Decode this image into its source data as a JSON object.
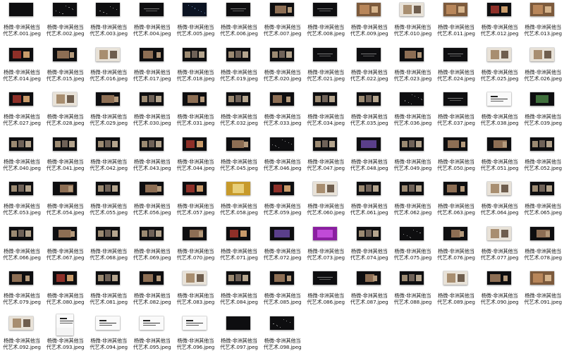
{
  "finder": {
    "file_prefix_line1": "杨微-非洲其他当",
    "file_prefix_line2": "代艺术",
    "extension": ".jpeg",
    "files": [
      {
        "num": "001",
        "label1": "杨微-非洲其他当",
        "label2": "代艺术.001.jpeg",
        "style": "dark-empty"
      },
      {
        "num": "002",
        "label1": "杨微-非洲其他当",
        "label2": "代艺术.002.jpeg",
        "style": "dark-dots"
      },
      {
        "num": "003",
        "label1": "杨微-非洲其他当",
        "label2": "代艺术.003.jpeg",
        "style": "dark-dots"
      },
      {
        "num": "004",
        "label1": "杨微-非洲其他当",
        "label2": "代艺术.004.jpeg",
        "style": "dark-text"
      },
      {
        "num": "005",
        "label1": "杨微-非洲其他当",
        "label2": "代艺术.005.jpeg",
        "style": "dark-blue"
      },
      {
        "num": "006",
        "label1": "杨微-非洲其他当",
        "label2": "代艺术.006.jpeg",
        "style": "dark-text"
      },
      {
        "num": "007",
        "label1": "杨微-非洲其他当",
        "label2": "代艺术.007.jpeg",
        "style": "dark-photo"
      },
      {
        "num": "008",
        "label1": "杨微-非洲其他当",
        "label2": "代艺术.008.jpeg",
        "style": "dark-text"
      },
      {
        "num": "009",
        "label1": "杨微-非洲其他当",
        "label2": "代艺术.009.jpeg",
        "style": "photo-warm"
      },
      {
        "num": "010",
        "label1": "杨微-非洲其他当",
        "label2": "代艺术.010.jpeg",
        "style": "light-photo"
      },
      {
        "num": "011",
        "label1": "杨微-非洲其他当",
        "label2": "代艺术.011.jpeg",
        "style": "photo-warm"
      },
      {
        "num": "012",
        "label1": "杨微-非洲其他当",
        "label2": "代艺术.012.jpeg",
        "style": "dark-red"
      },
      {
        "num": "013",
        "label1": "杨微-非洲其他当",
        "label2": "代艺术.013.jpeg",
        "style": "photo-warm"
      },
      {
        "num": "014",
        "label1": "杨微-非洲其他当",
        "label2": "代艺术.014.jpeg",
        "style": "dark-red"
      },
      {
        "num": "015",
        "label1": "杨微-非洲其他当",
        "label2": "代艺术.015.jpeg",
        "style": "dark-photo"
      },
      {
        "num": "016",
        "label1": "杨微-非洲其他当",
        "label2": "代艺术.016.jpeg",
        "style": "light-photo"
      },
      {
        "num": "017",
        "label1": "杨微-非洲其他当",
        "label2": "代艺术.017.jpeg",
        "style": "dark-photo"
      },
      {
        "num": "018",
        "label1": "杨微-非洲其他当",
        "label2": "代艺术.018.jpeg",
        "style": "dark-photos"
      },
      {
        "num": "019",
        "label1": "杨微-非洲其他当",
        "label2": "代艺术.019.jpeg",
        "style": "dark-photos"
      },
      {
        "num": "020",
        "label1": "杨微-非洲其他当",
        "label2": "代艺术.020.jpeg",
        "style": "dark-photos"
      },
      {
        "num": "021",
        "label1": "杨微-非洲其他当",
        "label2": "代艺术.021.jpeg",
        "style": "dark-text"
      },
      {
        "num": "022",
        "label1": "杨微-非洲其他当",
        "label2": "代艺术.022.jpeg",
        "style": "dark-text"
      },
      {
        "num": "023",
        "label1": "杨微-非洲其他当",
        "label2": "代艺术.023.jpeg",
        "style": "dark-photo"
      },
      {
        "num": "024",
        "label1": "杨微-非洲其他当",
        "label2": "代艺术.024.jpeg",
        "style": "dark-text"
      },
      {
        "num": "025",
        "label1": "杨微-非洲其他当",
        "label2": "代艺术.025.jpeg",
        "style": "light-photo"
      },
      {
        "num": "026",
        "label1": "杨微-非洲其他当",
        "label2": "代艺术.026.jpeg",
        "style": "light-photo"
      },
      {
        "num": "027",
        "label1": "杨微-非洲其他当",
        "label2": "代艺术.027.jpeg",
        "style": "dark-red"
      },
      {
        "num": "028",
        "label1": "杨微-非洲其他当",
        "label2": "代艺术.028.jpeg",
        "style": "light-photo"
      },
      {
        "num": "029",
        "label1": "杨微-非洲其他当",
        "label2": "代艺术.029.jpeg",
        "style": "dark-photo"
      },
      {
        "num": "030",
        "label1": "杨微-非洲其他当",
        "label2": "代艺术.030.jpeg",
        "style": "dark-photos"
      },
      {
        "num": "031",
        "label1": "杨微-非洲其他当",
        "label2": "代艺术.031.jpeg",
        "style": "dark-photo"
      },
      {
        "num": "032",
        "label1": "杨微-非洲其他当",
        "label2": "代艺术.032.jpeg",
        "style": "dark-photos"
      },
      {
        "num": "033",
        "label1": "杨微-非洲其他当",
        "label2": "代艺术.033.jpeg",
        "style": "dark-photo"
      },
      {
        "num": "034",
        "label1": "杨微-非洲其他当",
        "label2": "代艺术.034.jpeg",
        "style": "dark-photos"
      },
      {
        "num": "035",
        "label1": "杨微-非洲其他当",
        "label2": "代艺术.035.jpeg",
        "style": "dark-photos"
      },
      {
        "num": "036",
        "label1": "杨微-非洲其他当",
        "label2": "代艺术.036.jpeg",
        "style": "dark-dots"
      },
      {
        "num": "037",
        "label1": "杨微-非洲其他当",
        "label2": "代艺术.037.jpeg",
        "style": "dark-text"
      },
      {
        "num": "038",
        "label1": "杨微-非洲其他当",
        "label2": "代艺术.038.jpeg",
        "style": "white-doc"
      },
      {
        "num": "039",
        "label1": "杨微-非洲其他当",
        "label2": "代艺术.039.jpeg",
        "style": "dark-green"
      },
      {
        "num": "040",
        "label1": "杨微-非洲其他当",
        "label2": "代艺术.040.jpeg",
        "style": "dark-photos"
      },
      {
        "num": "041",
        "label1": "杨微-非洲其他当",
        "label2": "代艺术.041.jpeg",
        "style": "dark-photos"
      },
      {
        "num": "042",
        "label1": "杨微-非洲其他当",
        "label2": "代艺术.042.jpeg",
        "style": "dark-photos"
      },
      {
        "num": "043",
        "label1": "杨微-非洲其他当",
        "label2": "代艺术.043.jpeg",
        "style": "dark-photos"
      },
      {
        "num": "044",
        "label1": "杨微-非洲其他当",
        "label2": "代艺术.044.jpeg",
        "style": "dark-red"
      },
      {
        "num": "045",
        "label1": "杨微-非洲其他当",
        "label2": "代艺术.045.jpeg",
        "style": "dark-photo"
      },
      {
        "num": "046",
        "label1": "杨微-非洲其他当",
        "label2": "代艺术.046.jpeg",
        "style": "dark-dots"
      },
      {
        "num": "047",
        "label1": "杨微-非洲其他当",
        "label2": "代艺术.047.jpeg",
        "style": "dark-photos"
      },
      {
        "num": "048",
        "label1": "杨微-非洲其他当",
        "label2": "代艺术.048.jpeg",
        "style": "dark-purple"
      },
      {
        "num": "049",
        "label1": "杨微-非洲其他当",
        "label2": "代艺术.049.jpeg",
        "style": "dark-photos"
      },
      {
        "num": "050",
        "label1": "杨微-非洲其他当",
        "label2": "代艺术.050.jpeg",
        "style": "dark-photo"
      },
      {
        "num": "051",
        "label1": "杨微-非洲其他当",
        "label2": "代艺术.051.jpeg",
        "style": "dark-photo"
      },
      {
        "num": "052",
        "label1": "杨微-非洲其他当",
        "label2": "代艺术.052.jpeg",
        "style": "dark-photos"
      },
      {
        "num": "053",
        "label1": "杨微-非洲其他当",
        "label2": "代艺术.053.jpeg",
        "style": "dark-photos"
      },
      {
        "num": "054",
        "label1": "杨微-非洲其他当",
        "label2": "代艺术.054.jpeg",
        "style": "dark-photo"
      },
      {
        "num": "055",
        "label1": "杨微-非洲其他当",
        "label2": "代艺术.055.jpeg",
        "style": "dark-photos"
      },
      {
        "num": "056",
        "label1": "杨微-非洲其他当",
        "label2": "代艺术.056.jpeg",
        "style": "dark-photo"
      },
      {
        "num": "057",
        "label1": "杨微-非洲其他当",
        "label2": "代艺术.057.jpeg",
        "style": "dark-red"
      },
      {
        "num": "058",
        "label1": "杨微-非洲其他当",
        "label2": "代艺术.058.jpeg",
        "style": "yellow-photo"
      },
      {
        "num": "059",
        "label1": "杨微-非洲其他当",
        "label2": "代艺术.059.jpeg",
        "style": "dark-red"
      },
      {
        "num": "060",
        "label1": "杨微-非洲其他当",
        "label2": "代艺术.060.jpeg",
        "style": "light-photo"
      },
      {
        "num": "061",
        "label1": "杨微-非洲其他当",
        "label2": "代艺术.061.jpeg",
        "style": "dark-photos"
      },
      {
        "num": "062",
        "label1": "杨微-非洲其他当",
        "label2": "代艺术.062.jpeg",
        "style": "dark-photos"
      },
      {
        "num": "063",
        "label1": "杨微-非洲其他当",
        "label2": "代艺术.063.jpeg",
        "style": "dark-photo"
      },
      {
        "num": "064",
        "label1": "杨微-非洲其他当",
        "label2": "代艺术.064.jpeg",
        "style": "light-photo"
      },
      {
        "num": "065",
        "label1": "杨微-非洲其他当",
        "label2": "代艺术.065.jpeg",
        "style": "dark-photos"
      },
      {
        "num": "066",
        "label1": "杨微-非洲其他当",
        "label2": "代艺术.066.jpeg",
        "style": "dark-photos"
      },
      {
        "num": "067",
        "label1": "杨微-非洲其他当",
        "label2": "代艺术.067.jpeg",
        "style": "dark-photo"
      },
      {
        "num": "068",
        "label1": "杨微-非洲其他当",
        "label2": "代艺术.068.jpeg",
        "style": "dark-photos"
      },
      {
        "num": "069",
        "label1": "杨微-非洲其他当",
        "label2": "代艺术.069.jpeg",
        "style": "dark-photos"
      },
      {
        "num": "070",
        "label1": "杨微-非洲其他当",
        "label2": "代艺术.070.jpeg",
        "style": "dark-photo"
      },
      {
        "num": "071",
        "label1": "杨微-非洲其他当",
        "label2": "代艺术.071.jpeg",
        "style": "dark-red"
      },
      {
        "num": "072",
        "label1": "杨微-非洲其他当",
        "label2": "代艺术.072.jpeg",
        "style": "dark-purple"
      },
      {
        "num": "073",
        "label1": "杨微-非洲其他当",
        "label2": "代艺术.073.jpeg",
        "style": "magenta"
      },
      {
        "num": "074",
        "label1": "杨微-非洲其他当",
        "label2": "代艺术.074.jpeg",
        "style": "dark-photos"
      },
      {
        "num": "075",
        "label1": "杨微-非洲其他当",
        "label2": "代艺术.075.jpeg",
        "style": "dark-dots"
      },
      {
        "num": "076",
        "label1": "杨微-非洲其他当",
        "label2": "代艺术.076.jpeg",
        "style": "dark-photo"
      },
      {
        "num": "077",
        "label1": "杨微-非洲其他当",
        "label2": "代艺术.077.jpeg",
        "style": "light-photo"
      },
      {
        "num": "078",
        "label1": "杨微-非洲其他当",
        "label2": "代艺术.078.jpeg",
        "style": "dark-photo"
      },
      {
        "num": "079",
        "label1": "杨微-非洲其他当",
        "label2": "代艺术.079.jpeg",
        "style": "dark-photo"
      },
      {
        "num": "080",
        "label1": "杨微-非洲其他当",
        "label2": "代艺术.080.jpeg",
        "style": "dark-red"
      },
      {
        "num": "081",
        "label1": "杨微-非洲其他当",
        "label2": "代艺术.081.jpeg",
        "style": "dark-photos"
      },
      {
        "num": "082",
        "label1": "杨微-非洲其他当",
        "label2": "代艺术.082.jpeg",
        "style": "dark-photo"
      },
      {
        "num": "083",
        "label1": "杨微-非洲其他当",
        "label2": "代艺术.083.jpeg",
        "style": "light-photo"
      },
      {
        "num": "084",
        "label1": "杨微-非洲其他当",
        "label2": "代艺术.084.jpeg",
        "style": "dark-photos"
      },
      {
        "num": "085",
        "label1": "杨微-非洲其他当",
        "label2": "代艺术.085.jpeg",
        "style": "dark-photo"
      },
      {
        "num": "086",
        "label1": "杨微-非洲其他当",
        "label2": "代艺术.086.jpeg",
        "style": "dark-text"
      },
      {
        "num": "087",
        "label1": "杨微-非洲其他当",
        "label2": "代艺术.087.jpeg",
        "style": "dark-photo"
      },
      {
        "num": "088",
        "label1": "杨微-非洲其他当",
        "label2": "代艺术.088.jpeg",
        "style": "dark-photos"
      },
      {
        "num": "089",
        "label1": "杨微-非洲其他当",
        "label2": "代艺术.089.jpeg",
        "style": "light-photo"
      },
      {
        "num": "090",
        "label1": "杨微-非洲其他当",
        "label2": "代艺术.090.jpeg",
        "style": "dark-photo"
      },
      {
        "num": "091",
        "label1": "杨微-非洲其他当",
        "label2": "代艺术.091.jpeg",
        "style": "photo-warm"
      },
      {
        "num": "092",
        "label1": "杨微-非洲其他当",
        "label2": "代艺术.092.jpeg",
        "style": "light-photo"
      },
      {
        "num": "093",
        "label1": "杨微-非洲其他当",
        "label2": "代艺术.093.jpeg",
        "style": "white-doc"
      },
      {
        "num": "094",
        "label1": "杨微-非洲其他当",
        "label2": "代艺术.094.jpeg",
        "style": "white-doc"
      },
      {
        "num": "095",
        "label1": "杨微-非洲其他当",
        "label2": "代艺术.095.jpeg",
        "style": "white-doc"
      },
      {
        "num": "096",
        "label1": "杨微-非洲其他当",
        "label2": "代艺术.096.jpeg",
        "style": "white-doc"
      },
      {
        "num": "097",
        "label1": "杨微-非洲其他当",
        "label2": "代艺术.097.jpeg",
        "style": "dark-empty"
      },
      {
        "num": "098",
        "label1": "杨微-非洲其他当",
        "label2": "代艺术.098.jpeg",
        "style": "dark-dots"
      }
    ]
  }
}
